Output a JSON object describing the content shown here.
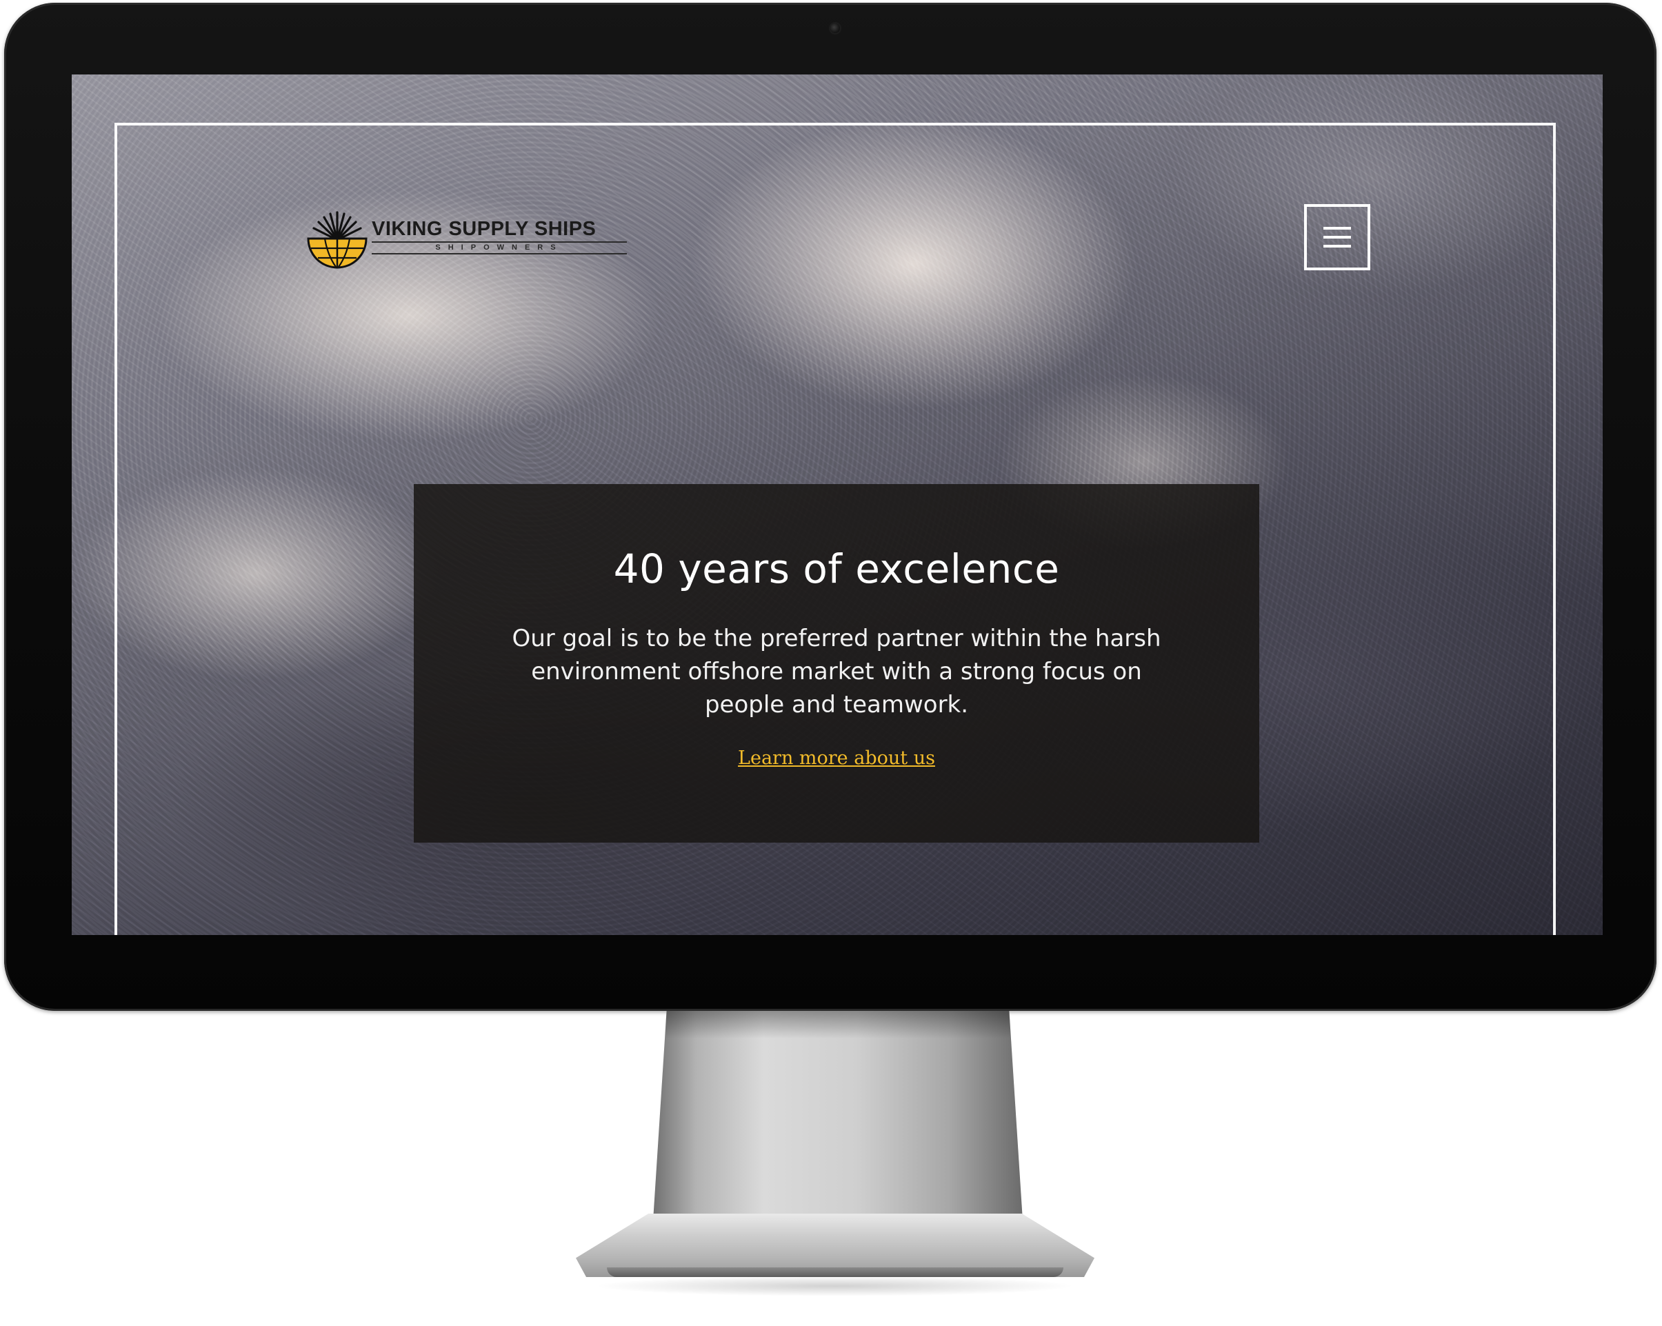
{
  "logo": {
    "name": "VIKING SUPPLY SHIPS",
    "tagline": "SHIPOWNERS",
    "accent_color": "#f2b826"
  },
  "menu": {
    "icon": "hamburger-menu-icon"
  },
  "hero": {
    "title": "40 years of excelence",
    "text": "Our goal is to be the preferred partner within the harsh environment offshore market with a strong focus on people and teamwork.",
    "link_label": "Learn more about us",
    "link_color": "#f2bb2a",
    "card_color": "#181614"
  }
}
